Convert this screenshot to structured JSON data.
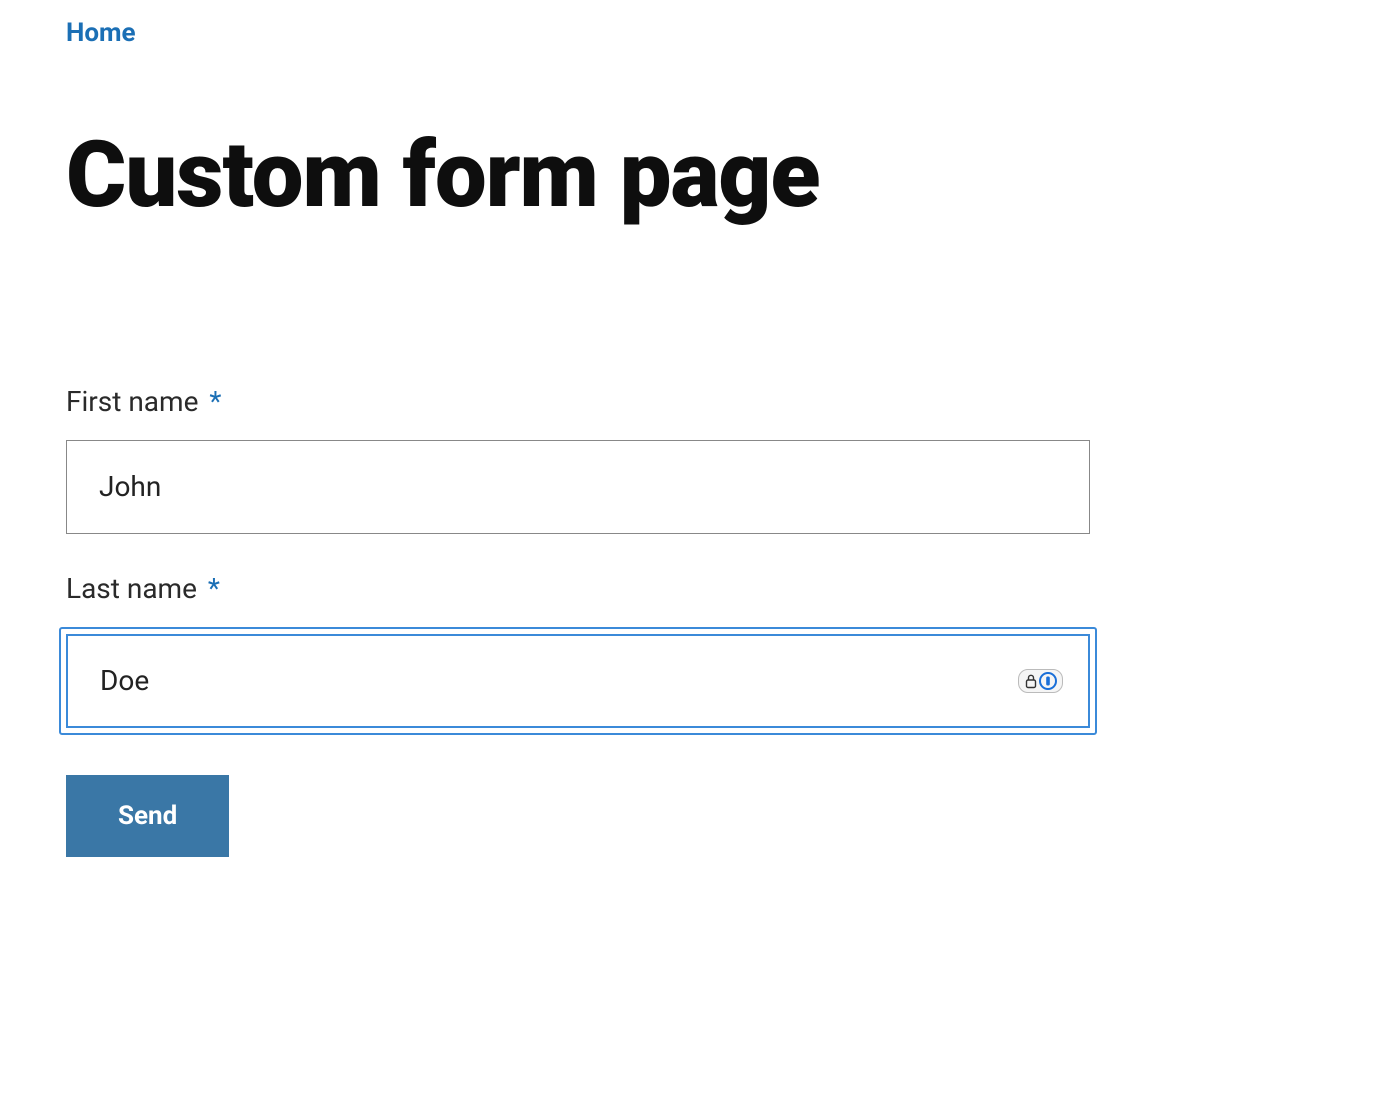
{
  "breadcrumb": {
    "home": "Home"
  },
  "page": {
    "title": "Custom form page"
  },
  "form": {
    "fields": {
      "first_name": {
        "label": "First name",
        "required_mark": "*",
        "value": "John"
      },
      "last_name": {
        "label": "Last name",
        "required_mark": "*",
        "value": "Doe"
      }
    },
    "submit_label": "Send"
  },
  "icons": {
    "lock": "lock-icon",
    "onepassword": "onepassword-icon"
  }
}
